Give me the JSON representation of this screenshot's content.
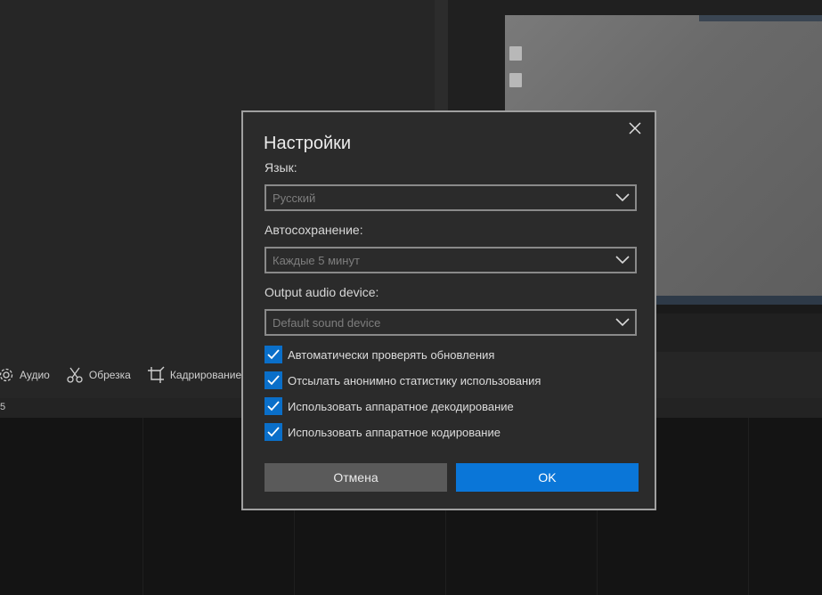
{
  "toolbar": {
    "audio_label": "Аудио",
    "trim_label": "Обрезка",
    "crop_label": "Кадрирование"
  },
  "ruler": {
    "label": "5"
  },
  "dialog": {
    "title": "Настройки",
    "language": {
      "label": "Язык:",
      "value": "Русский"
    },
    "autosave": {
      "label": "Автосохранение:",
      "value": "Каждые 5 минут"
    },
    "audio_device": {
      "label": "Output audio device:",
      "value": "Default sound device"
    },
    "checkboxes": [
      {
        "label": "Автоматически проверять обновления",
        "checked": true
      },
      {
        "label": "Отсылать анонимно статистику использования",
        "checked": true
      },
      {
        "label": "Использовать аппаратное декодирование",
        "checked": true
      },
      {
        "label": "Использовать аппаратное кодирование",
        "checked": true
      }
    ],
    "cancel_label": "Отмена",
    "ok_label": "OK"
  },
  "colors": {
    "accent": "#0a76d8",
    "checkbox": "#0a6fc9",
    "dialog_bg": "#2b2b2b"
  }
}
